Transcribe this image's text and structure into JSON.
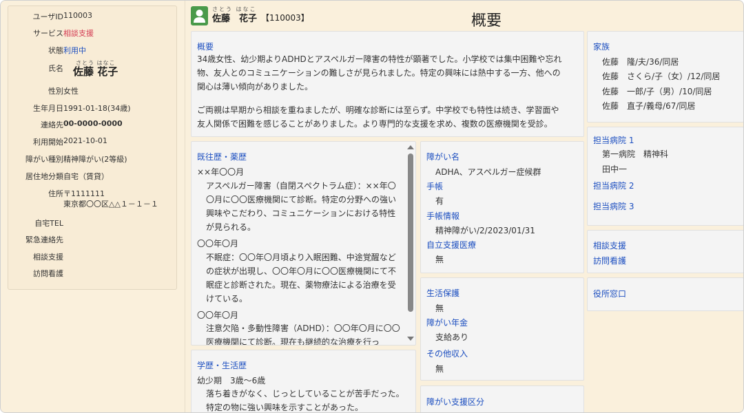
{
  "profile": {
    "user_id_label": "ユーザID",
    "user_id": "110003",
    "service_label": "サービス",
    "service": "相談支援",
    "status_label": "状態",
    "status": "利用中",
    "name_label": "氏名",
    "name_ruby": "さとう はなこ",
    "name": "佐藤 花子",
    "gender_label": "性別",
    "gender": "女性",
    "birth_label": "生年月日",
    "birth": "1991-01-18(34歳)",
    "contact_label": "連絡先",
    "contact": "00-0000-0000",
    "start_label": "利用開始",
    "start": "2021-10-01",
    "disability_type_label": "障がい種別",
    "disability_type": "精神障がい(2等級)",
    "residence_label": "居住地分類",
    "residence": "自宅（賃貸）",
    "address_label": "住所",
    "postal": "〒1111111",
    "address": "東京都〇〇区△△１－１－１",
    "home_tel_label": "自宅TEL",
    "emergency_label": "緊急連絡先",
    "consult_label": "相談支援",
    "nursing_label": "訪問看護"
  },
  "header": {
    "name_ruby": "さとう はなこ",
    "name": "佐藤　花子",
    "id": "【110003】",
    "title": "概要"
  },
  "overview": {
    "title": "概要",
    "p1": "34歳女性、幼少期よりADHDとアスペルガー障害の特性が顕著でした。小学校では集中困難や忘れ物、友人とのコミュニケーションの難しさが見られました。特定の興味には熱中する一方、他への関心は薄い傾向がありました。",
    "p2": "ご両親は早期から相談を重ねましたが、明確な診断には至らず。中学校でも特性は続き、学習面や友人関係で困難を感じることがありました。より専門的な支援を求め、複数の医療機関を受診。"
  },
  "history": {
    "title": "既往歴・薬歴",
    "entries": [
      {
        "date": "××年〇〇月",
        "text": "アスペルガー障害（自閉スペクトラム症）：××年〇〇月に〇〇医療機関にて診断。特定の分野への強い興味やこだわり、コミュニケーションにおける特性が見られる。"
      },
      {
        "date": "〇〇年〇月",
        "text": "不眠症：〇〇年〇月頃より入眠困難、中途覚醒などの症状が出現し、〇〇年〇月に〇〇医療機関にて不眠症と診断された。現在、薬物療法による治療を受けている。"
      },
      {
        "date": "〇〇年〇月",
        "text": "注意欠陥・多動性障害（ADHD）：〇〇年〇月に〇〇医療機関にて診断。現在も継続的な治療を行っ"
      }
    ]
  },
  "education": {
    "title": "学歴・生活歴",
    "period": "幼少期　3歳～6歳",
    "text": "落ち着きがなく、じっとしていることが苦手だった。特定の物に強い興味を示すことがあった。"
  },
  "disability": {
    "name_title": "障がい名",
    "name_value": "ADHA、アスペルガー症候群",
    "notebook_title": "手帳",
    "notebook_value": "有",
    "notebook_info_title": "手帳情報",
    "notebook_info_value": "精神障がい/2/2023/01/31",
    "self_support_title": "自立支援医療",
    "self_support_value": "無"
  },
  "income": {
    "welfare_title": "生活保護",
    "welfare_value": "無",
    "pension_title": "障がい年金",
    "pension_value": "支給あり",
    "other_title": "その他収入",
    "other_value": "無"
  },
  "support_level": {
    "title": "障がい支援区分"
  },
  "family": {
    "title": "家族",
    "members": [
      {
        "surname": "佐藤",
        "detail": "隆/夫/36/同居"
      },
      {
        "surname": "佐藤",
        "detail": "さくら/子（女）/12/同居"
      },
      {
        "surname": "佐藤",
        "detail": "一郎/子（男）/10/同居"
      },
      {
        "surname": "佐藤",
        "detail": "直子/義母/67/同居"
      }
    ]
  },
  "hospitals": {
    "h1_title": "担当病院 1",
    "h1_name": "第一病院　精神科",
    "h1_doctor": "田中一",
    "h2_title": "担当病院 2",
    "h3_title": "担当病院 3"
  },
  "services": {
    "consult": "相談支援",
    "nursing": "訪問看護"
  },
  "office": {
    "title": "役所窓口"
  }
}
